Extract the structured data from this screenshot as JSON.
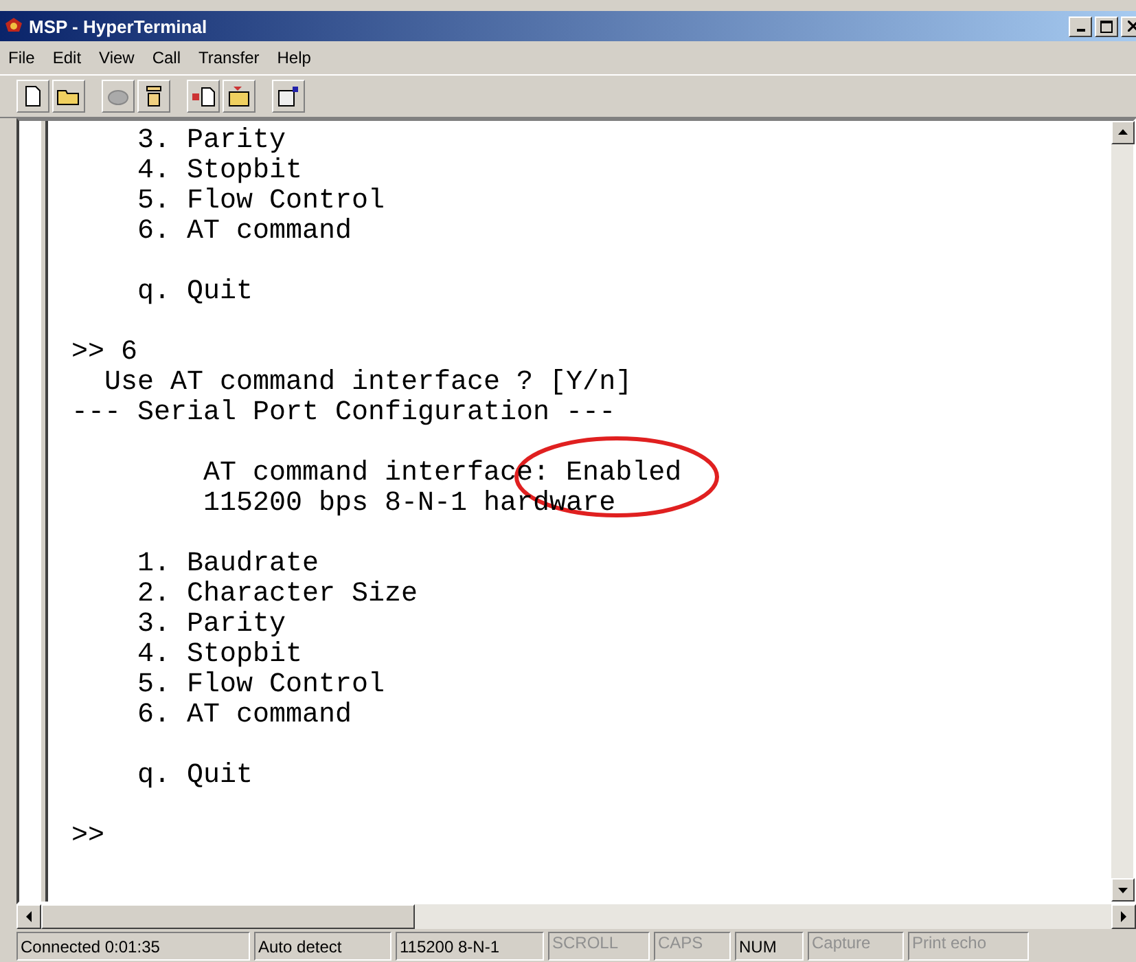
{
  "window": {
    "title": "MSP - HyperTerminal"
  },
  "menu": [
    "File",
    "Edit",
    "View",
    "Call",
    "Transfer",
    "Help"
  ],
  "terminal": {
    "lines": [
      {
        "kind": "text",
        "text": "    3. Parity"
      },
      {
        "kind": "text",
        "text": "    4. Stopbit"
      },
      {
        "kind": "text",
        "text": "    5. Flow Control"
      },
      {
        "kind": "text",
        "text": "    6. AT command"
      },
      {
        "kind": "blank"
      },
      {
        "kind": "text",
        "text": "    q. Quit"
      },
      {
        "kind": "blank"
      },
      {
        "kind": "text",
        "text": ">> 6"
      },
      {
        "kind": "text",
        "text": "  Use AT command interface ? [Y/n]"
      },
      {
        "kind": "text",
        "text": "--- Serial Port Configuration ---"
      },
      {
        "kind": "blank"
      },
      {
        "kind": "text",
        "text": "        AT command interface: Enabled"
      },
      {
        "kind": "text",
        "text": "        115200 bps 8-N-1 hardware"
      },
      {
        "kind": "blank"
      },
      {
        "kind": "text",
        "text": "    1. Baudrate"
      },
      {
        "kind": "text",
        "text": "    2. Character Size"
      },
      {
        "kind": "text",
        "text": "    3. Parity"
      },
      {
        "kind": "text",
        "text": "    4. Stopbit"
      },
      {
        "kind": "text",
        "text": "    5. Flow Control"
      },
      {
        "kind": "text",
        "text": "    6. AT command"
      },
      {
        "kind": "blank"
      },
      {
        "kind": "text",
        "text": "    q. Quit"
      },
      {
        "kind": "blank"
      },
      {
        "kind": "text",
        "text": ">>"
      }
    ]
  },
  "status_bar": [
    {
      "text": "Connected 0:01:35",
      "on": true
    },
    {
      "text": "Auto detect",
      "on": true
    },
    {
      "text": "115200 8-N-1",
      "on": true
    },
    {
      "text": "SCROLL",
      "on": false
    },
    {
      "text": "CAPS",
      "on": false
    },
    {
      "text": "NUM",
      "on": true
    },
    {
      "text": "Capture",
      "on": false
    },
    {
      "text": "Print echo",
      "on": false
    }
  ]
}
